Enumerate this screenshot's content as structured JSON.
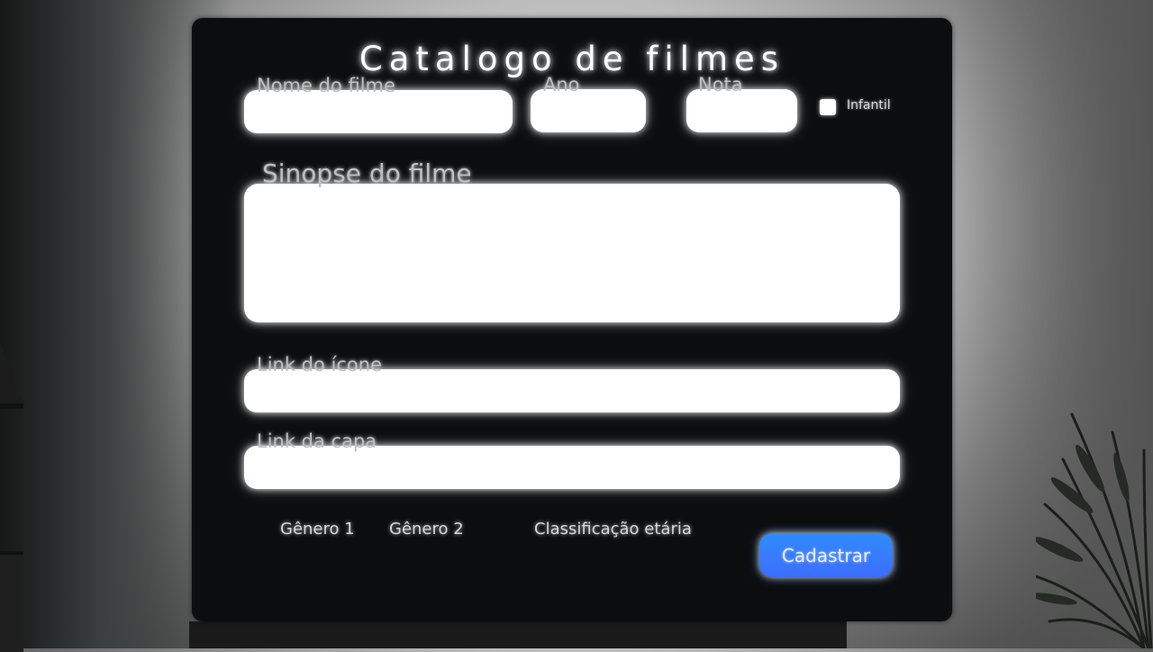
{
  "form": {
    "title": "Catalogo de filmes",
    "fields": {
      "name_label": "Nome do filme",
      "year_label": "Ano",
      "rating_label": "Nota",
      "kids_label": "Infantil",
      "synopsis_label": "Sinopse do filme",
      "icon_link_label": "Link do ícone",
      "cover_link_label": "Link da capa"
    },
    "bottom": {
      "genre1_label": "Gênero 1",
      "genre2_label": "Gênero 2",
      "age_rating_label": "Classificação etária"
    },
    "submit_label": "Cadastrar"
  },
  "colors": {
    "panel": "#0b0d0f",
    "field": "#ffffff",
    "button_start": "#2f8cff",
    "button_end": "#3d6dff"
  }
}
